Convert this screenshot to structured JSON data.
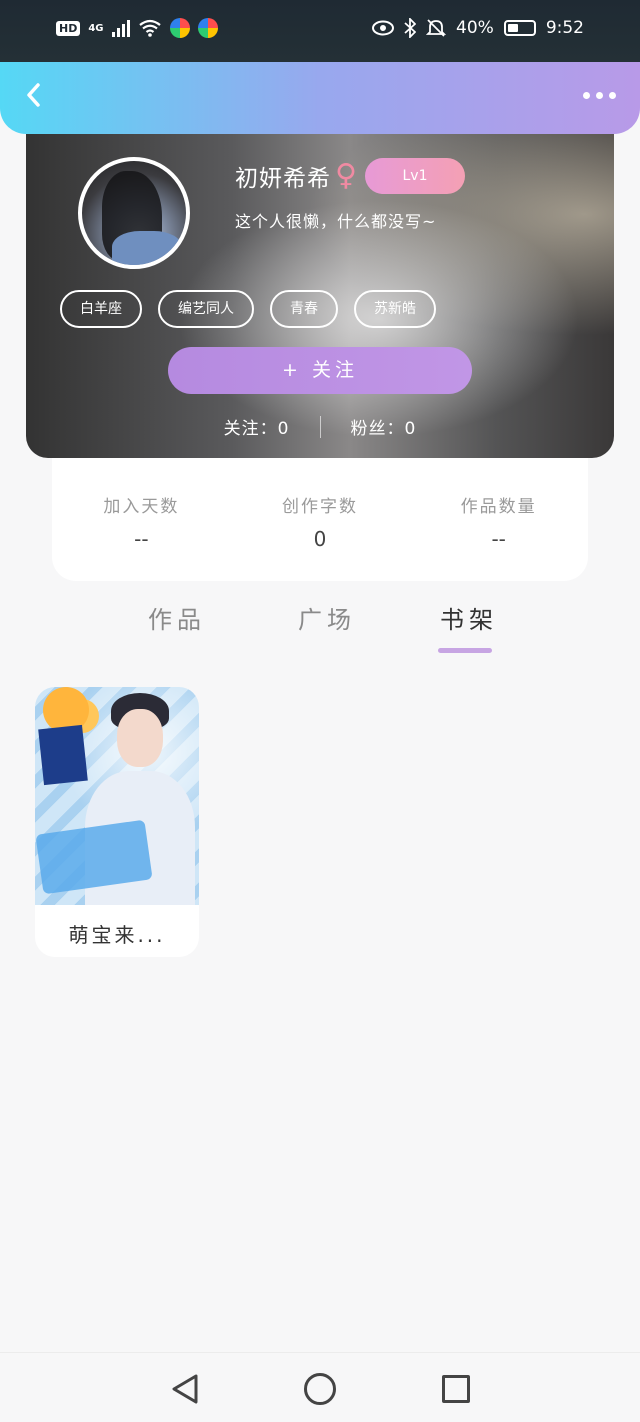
{
  "status_bar": {
    "hd": "HD",
    "network": "4G",
    "battery_percent": "40%",
    "time": "9:52"
  },
  "nav": {
    "back_icon": "chevron-left-icon",
    "more_icon": "more-horizontal-icon"
  },
  "profile": {
    "name": "初妍希希",
    "gender_symbol": "♀",
    "level": "Lv1",
    "bio": "这个人很懒，什么都没写~",
    "tags": [
      "白羊座",
      "编艺同人",
      "青春",
      "苏新皓"
    ],
    "follow_button": "+ 关注",
    "following": "关注：0",
    "followers": "粉丝：0"
  },
  "stats": [
    {
      "label": "加入天数",
      "value": "--"
    },
    {
      "label": "创作字数",
      "value": "0"
    },
    {
      "label": "作品数量",
      "value": "--"
    }
  ],
  "tabs": {
    "items": [
      "作品",
      "广场",
      "书架"
    ],
    "active": "书架"
  },
  "bookshelf": [
    {
      "title": "萌宝来..."
    }
  ],
  "colors": {
    "nav_gradient_start": "#55d8f5",
    "nav_gradient_end": "#b89ae8",
    "follow_button": "#b58ae0",
    "level_badge": "#f4a0b4",
    "tab_underline": "#c7a5e3",
    "gender": "#f08aa2"
  }
}
